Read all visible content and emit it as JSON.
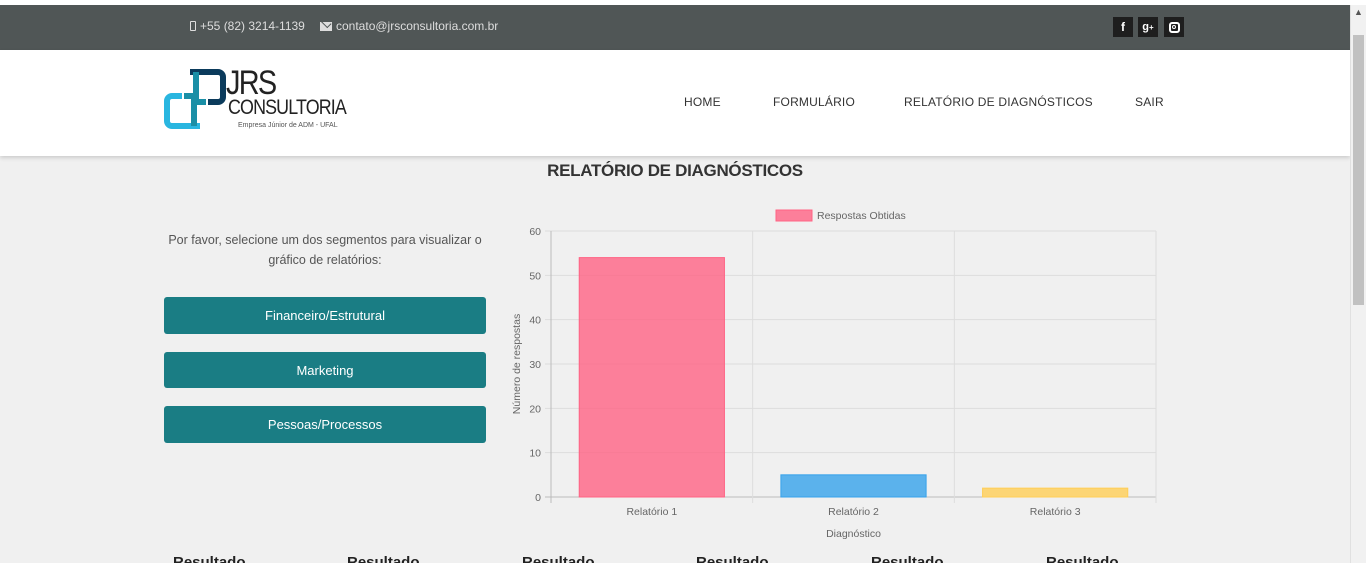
{
  "topbar": {
    "phone": "+55 (82) 3214-1139",
    "email": "contato@jrsconsultoria.com.br",
    "social": [
      "facebook-icon",
      "google-plus-icon",
      "instagram-icon"
    ]
  },
  "logo": {
    "name": "JRS",
    "line2": "CONSULTORIA",
    "tagline": "Empresa Júnior de ADM - UFAL"
  },
  "nav": {
    "items": [
      "HOME",
      "FORMULÁRIO",
      "RELATÓRIO DE DIAGNÓSTICOS",
      "SAIR"
    ]
  },
  "page_title": "RELATÓRIO DE DIAGNÓSTICOS",
  "instructions": "Por favor, selecione um dos segmentos para visualizar o gráfico de relatórios:",
  "segments": [
    "Financeiro/Estrutural",
    "Marketing",
    "Pessoas/Processos"
  ],
  "bottom_row": [
    "Resultado",
    "Resultado",
    "Resultado",
    "Resultado",
    "Resultado",
    "Resultado"
  ],
  "colors": {
    "topbar": "#505656",
    "button": "#1a7d84",
    "bar1": "#ff6384",
    "bar2": "#36a2eb",
    "bar3": "#ffce56"
  },
  "chart_data": {
    "type": "bar",
    "categories": [
      "Relatório 1",
      "Relatório 2",
      "Relatório 3"
    ],
    "series": [
      {
        "name": "Respostas Obtidas",
        "values": [
          54,
          5,
          2
        ],
        "colors": [
          "#ff6384",
          "#36a2eb",
          "#ffce56"
        ]
      }
    ],
    "xlabel": "Diagnóstico",
    "ylabel": "Número de respostas",
    "ylim": [
      0,
      60
    ],
    "yticks": [
      0,
      10,
      20,
      30,
      40,
      50,
      60
    ],
    "grid": true,
    "legend": "top"
  }
}
